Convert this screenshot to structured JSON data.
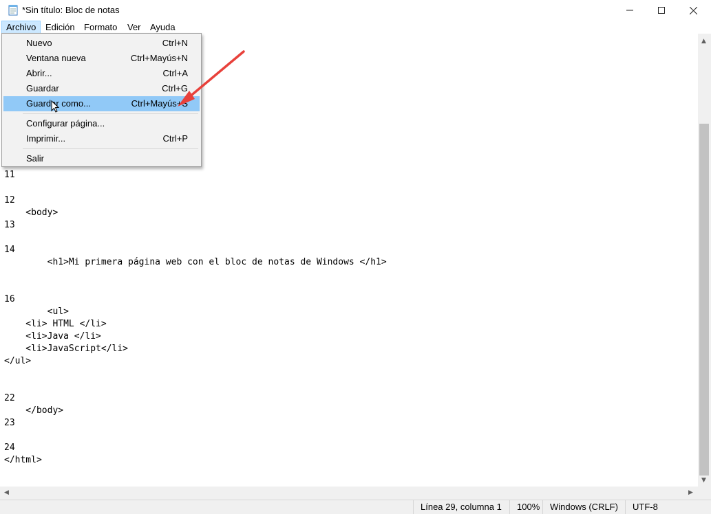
{
  "window": {
    "title": "*Sin título: Bloc de notas",
    "minimize_icon": "minimize-icon",
    "maximize_icon": "maximize-icon",
    "close_icon": "close-icon"
  },
  "menubar": {
    "items": [
      "Archivo",
      "Edición",
      "Formato",
      "Ver",
      "Ayuda"
    ]
  },
  "file_menu": {
    "items": [
      {
        "label": "Nuevo",
        "shortcut": "Ctrl+N"
      },
      {
        "label": "Ventana nueva",
        "shortcut": "Ctrl+Mayús+N"
      },
      {
        "label": "Abrir...",
        "shortcut": "Ctrl+A"
      },
      {
        "label": "Guardar",
        "shortcut": "Ctrl+G"
      },
      {
        "label": "Guardar como...",
        "shortcut": "Ctrl+Mayús+S"
      },
      {
        "label": "Configurar página...",
        "shortcut": ""
      },
      {
        "label": "Imprimir...",
        "shortcut": "Ctrl+P"
      },
      {
        "label": "Salir",
        "shortcut": ""
      }
    ],
    "highlighted": "Guardar como...",
    "highlight_color": "#91c9f7"
  },
  "editor": {
    "lines": [
      "11",
      "12",
      "    <body>",
      "13",
      "14",
      "        <h1>Mi primera página web con el bloc de notas de Windows </h1>",
      "16",
      "        <ul>",
      "    <li> HTML </li>",
      "    <li>Java </li>",
      "    <li>JavaScript</li>",
      "</ul>",
      "22",
      "    </body>",
      "23",
      "24",
      "</html>"
    ]
  },
  "statusbar": {
    "position": "Línea 29, columna 1",
    "zoom": "100%",
    "line_ending": "Windows (CRLF)",
    "encoding": "UTF-8"
  },
  "annotation": {
    "arrow_color": "#e8413b"
  }
}
